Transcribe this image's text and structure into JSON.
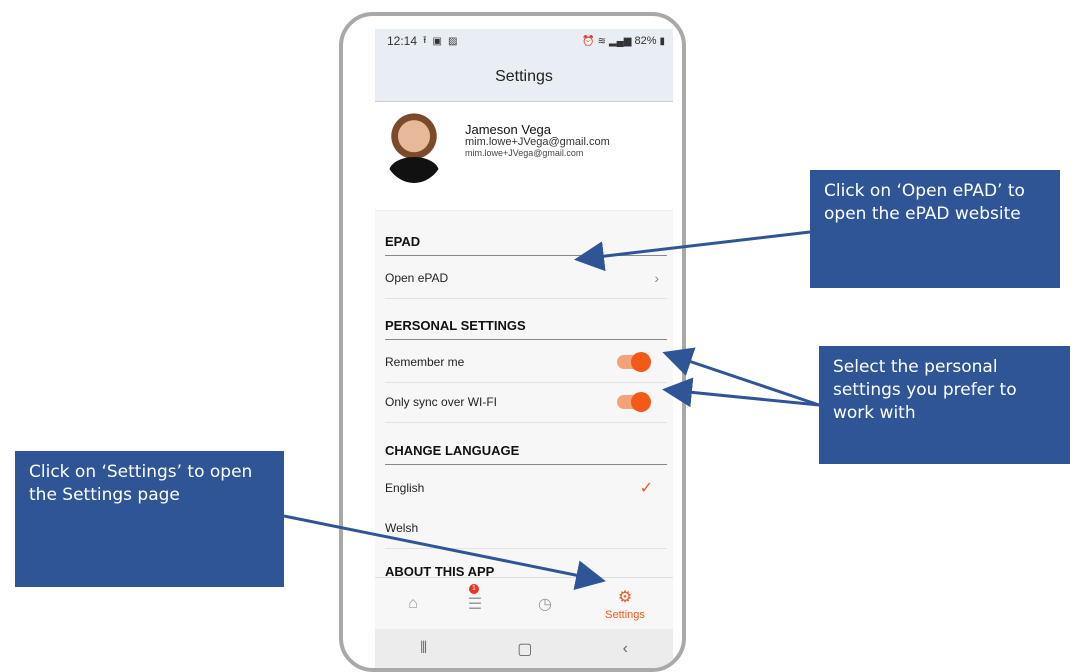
{
  "status_bar": {
    "time": "12:14",
    "battery": "82%"
  },
  "header": {
    "title": "Settings"
  },
  "profile": {
    "name": "Jameson Vega",
    "email_primary": "mim.lowe+JVega@gmail.com",
    "email_secondary": "mim.lowe+JVega@gmail.com"
  },
  "sections": {
    "epad": {
      "title": "EPAD",
      "open_label": "Open ePAD"
    },
    "personal": {
      "title": "PERSONAL SETTINGS",
      "remember_label": "Remember me",
      "sync_label": "Only sync over WI-FI",
      "remember_on": true,
      "sync_on": true
    },
    "language": {
      "title": "CHANGE LANGUAGE",
      "english": "English",
      "welsh": "Welsh",
      "selected": "English"
    },
    "about": {
      "title": "ABOUT THIS APP"
    }
  },
  "tabbar": {
    "settings_label": "Settings",
    "badge_count": "1",
    "active_tab": "Settings"
  },
  "callouts": {
    "epad": "Click on ‘Open ePAD’ to open the ePAD website",
    "personal": "Select the personal settings you prefer to work with",
    "settings": "Click on ‘Settings’ to open the Settings page"
  },
  "colors": {
    "accent": "#f25a1a",
    "callout": "#2f5597",
    "header_bg": "#e9eef4"
  },
  "icons": {
    "status": [
      "upload-icon",
      "notification-icon",
      "image-icon",
      "alarm-icon",
      "wifi-icon",
      "signal-icon",
      "battery-icon"
    ],
    "tabs": [
      "home-icon",
      "list-icon",
      "clock-icon",
      "gear-icon"
    ],
    "nav": [
      "recents-icon",
      "home-nav-icon",
      "back-icon"
    ]
  }
}
